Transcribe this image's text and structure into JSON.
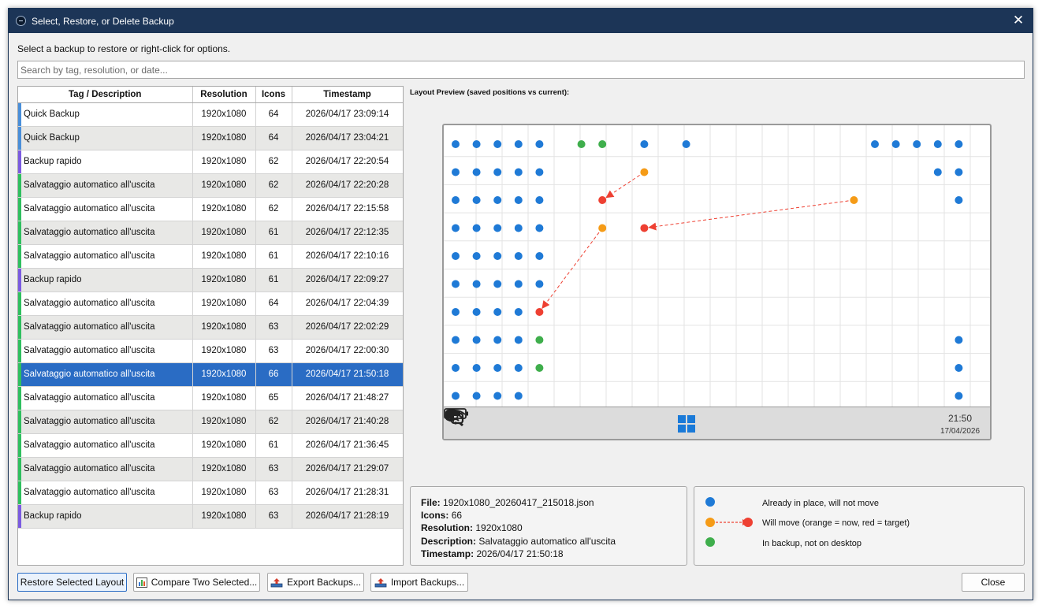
{
  "window": {
    "title": "Select, Restore, or Delete Backup",
    "close_glyph": "✕"
  },
  "instruction": "Select a backup to restore or right-click for options.",
  "search": {
    "placeholder": "Search by tag, resolution, or date...",
    "value": ""
  },
  "table": {
    "headers": [
      "Tag / Description",
      "Resolution",
      "Icons",
      "Timestamp"
    ],
    "selected_index": 11,
    "rows": [
      {
        "desc": "Quick Backup",
        "res": "1920x1080",
        "icons": "64",
        "ts": "2026/04/17 23:09:14",
        "tag_color": "#4a8fd9"
      },
      {
        "desc": "Quick Backup",
        "res": "1920x1080",
        "icons": "64",
        "ts": "2026/04/17 23:04:21",
        "tag_color": "#4a8fd9"
      },
      {
        "desc": "Backup rapido",
        "res": "1920x1080",
        "icons": "62",
        "ts": "2026/04/17 22:20:54",
        "tag_color": "#7b5be0"
      },
      {
        "desc": "Salvataggio automatico all'uscita",
        "res": "1920x1080",
        "icons": "62",
        "ts": "2026/04/17 22:20:28",
        "tag_color": "#2fbf5f"
      },
      {
        "desc": "Salvataggio automatico all'uscita",
        "res": "1920x1080",
        "icons": "62",
        "ts": "2026/04/17 22:15:58",
        "tag_color": "#2fbf5f"
      },
      {
        "desc": "Salvataggio automatico all'uscita",
        "res": "1920x1080",
        "icons": "61",
        "ts": "2026/04/17 22:12:35",
        "tag_color": "#2fbf5f"
      },
      {
        "desc": "Salvataggio automatico all'uscita",
        "res": "1920x1080",
        "icons": "61",
        "ts": "2026/04/17 22:10:16",
        "tag_color": "#2fbf5f"
      },
      {
        "desc": "Backup rapido",
        "res": "1920x1080",
        "icons": "61",
        "ts": "2026/04/17 22:09:27",
        "tag_color": "#7b5be0"
      },
      {
        "desc": "Salvataggio automatico all'uscita",
        "res": "1920x1080",
        "icons": "64",
        "ts": "2026/04/17 22:04:39",
        "tag_color": "#2fbf5f"
      },
      {
        "desc": "Salvataggio automatico all'uscita",
        "res": "1920x1080",
        "icons": "63",
        "ts": "2026/04/17 22:02:29",
        "tag_color": "#2fbf5f"
      },
      {
        "desc": "Salvataggio automatico all'uscita",
        "res": "1920x1080",
        "icons": "63",
        "ts": "2026/04/17 22:00:30",
        "tag_color": "#2fbf5f"
      },
      {
        "desc": "Salvataggio automatico all'uscita",
        "res": "1920x1080",
        "icons": "66",
        "ts": "2026/04/17 21:50:18",
        "tag_color": "#2fbf5f"
      },
      {
        "desc": "Salvataggio automatico all'uscita",
        "res": "1920x1080",
        "icons": "65",
        "ts": "2026/04/17 21:48:27",
        "tag_color": "#2fbf5f"
      },
      {
        "desc": "Salvataggio automatico all'uscita",
        "res": "1920x1080",
        "icons": "62",
        "ts": "2026/04/17 21:40:28",
        "tag_color": "#2fbf5f"
      },
      {
        "desc": "Salvataggio automatico all'uscita",
        "res": "1920x1080",
        "icons": "61",
        "ts": "2026/04/17 21:36:45",
        "tag_color": "#2fbf5f"
      },
      {
        "desc": "Salvataggio automatico all'uscita",
        "res": "1920x1080",
        "icons": "63",
        "ts": "2026/04/17 21:29:07",
        "tag_color": "#2fbf5f"
      },
      {
        "desc": "Salvataggio automatico all'uscita",
        "res": "1920x1080",
        "icons": "63",
        "ts": "2026/04/17 21:28:31",
        "tag_color": "#2fbf5f"
      },
      {
        "desc": "Backup rapido",
        "res": "1920x1080",
        "icons": "63",
        "ts": "2026/04/17 21:28:19",
        "tag_color": "#7b5be0"
      }
    ]
  },
  "preview": {
    "label": "Layout Preview (saved positions vs current):",
    "grid": {
      "cols": 21,
      "rows": 10
    },
    "colors": {
      "in_place": "#1f7ad6",
      "now": "#f59b17",
      "target": "#ee4032",
      "missing": "#3fae4c"
    },
    "icons": [
      {
        "c": 0,
        "r": 0,
        "type": "in_place"
      },
      {
        "c": 1,
        "r": 0,
        "type": "in_place"
      },
      {
        "c": 2,
        "r": 0,
        "type": "in_place"
      },
      {
        "c": 3,
        "r": 0,
        "type": "in_place"
      },
      {
        "c": 4,
        "r": 0,
        "type": "in_place"
      },
      {
        "c": 6,
        "r": 0,
        "type": "missing"
      },
      {
        "c": 7,
        "r": 0,
        "type": "missing"
      },
      {
        "c": 9,
        "r": 0,
        "type": "in_place"
      },
      {
        "c": 11,
        "r": 0,
        "type": "in_place"
      },
      {
        "c": 20,
        "r": 0,
        "type": "in_place"
      },
      {
        "c": 21,
        "r": 0,
        "type": "in_place"
      },
      {
        "c": 22,
        "r": 0,
        "type": "in_place"
      },
      {
        "c": 23,
        "r": 0,
        "type": "in_place"
      },
      {
        "c": 24,
        "r": 0,
        "type": "in_place"
      },
      {
        "c": 0,
        "r": 1,
        "type": "in_place"
      },
      {
        "c": 1,
        "r": 1,
        "type": "in_place"
      },
      {
        "c": 2,
        "r": 1,
        "type": "in_place"
      },
      {
        "c": 3,
        "r": 1,
        "type": "in_place"
      },
      {
        "c": 4,
        "r": 1,
        "type": "in_place"
      },
      {
        "c": 23,
        "r": 1,
        "type": "in_place"
      },
      {
        "c": 24,
        "r": 1,
        "type": "in_place"
      },
      {
        "c": 0,
        "r": 2,
        "type": "in_place"
      },
      {
        "c": 1,
        "r": 2,
        "type": "in_place"
      },
      {
        "c": 2,
        "r": 2,
        "type": "in_place"
      },
      {
        "c": 3,
        "r": 2,
        "type": "in_place"
      },
      {
        "c": 4,
        "r": 2,
        "type": "in_place"
      },
      {
        "c": 24,
        "r": 2,
        "type": "in_place"
      },
      {
        "c": 0,
        "r": 3,
        "type": "in_place"
      },
      {
        "c": 1,
        "r": 3,
        "type": "in_place"
      },
      {
        "c": 2,
        "r": 3,
        "type": "in_place"
      },
      {
        "c": 3,
        "r": 3,
        "type": "in_place"
      },
      {
        "c": 4,
        "r": 3,
        "type": "in_place"
      },
      {
        "c": 0,
        "r": 4,
        "type": "in_place"
      },
      {
        "c": 1,
        "r": 4,
        "type": "in_place"
      },
      {
        "c": 2,
        "r": 4,
        "type": "in_place"
      },
      {
        "c": 3,
        "r": 4,
        "type": "in_place"
      },
      {
        "c": 4,
        "r": 4,
        "type": "in_place"
      },
      {
        "c": 0,
        "r": 5,
        "type": "in_place"
      },
      {
        "c": 1,
        "r": 5,
        "type": "in_place"
      },
      {
        "c": 2,
        "r": 5,
        "type": "in_place"
      },
      {
        "c": 3,
        "r": 5,
        "type": "in_place"
      },
      {
        "c": 4,
        "r": 5,
        "type": "in_place"
      },
      {
        "c": 0,
        "r": 6,
        "type": "in_place"
      },
      {
        "c": 1,
        "r": 6,
        "type": "in_place"
      },
      {
        "c": 2,
        "r": 6,
        "type": "in_place"
      },
      {
        "c": 3,
        "r": 6,
        "type": "in_place"
      },
      {
        "c": 0,
        "r": 7,
        "type": "in_place"
      },
      {
        "c": 1,
        "r": 7,
        "type": "in_place"
      },
      {
        "c": 2,
        "r": 7,
        "type": "in_place"
      },
      {
        "c": 3,
        "r": 7,
        "type": "in_place"
      },
      {
        "c": 4,
        "r": 7,
        "type": "missing"
      },
      {
        "c": 24,
        "r": 7,
        "type": "in_place"
      },
      {
        "c": 0,
        "r": 8,
        "type": "in_place"
      },
      {
        "c": 1,
        "r": 8,
        "type": "in_place"
      },
      {
        "c": 2,
        "r": 8,
        "type": "in_place"
      },
      {
        "c": 3,
        "r": 8,
        "type": "in_place"
      },
      {
        "c": 4,
        "r": 8,
        "type": "missing"
      },
      {
        "c": 24,
        "r": 8,
        "type": "in_place"
      },
      {
        "c": 0,
        "r": 9,
        "type": "in_place"
      },
      {
        "c": 1,
        "r": 9,
        "type": "in_place"
      },
      {
        "c": 2,
        "r": 9,
        "type": "in_place"
      },
      {
        "c": 3,
        "r": 9,
        "type": "in_place"
      },
      {
        "c": 24,
        "r": 9,
        "type": "in_place"
      }
    ],
    "moves": [
      {
        "from": {
          "c": 9,
          "r": 1
        },
        "to": {
          "c": 7,
          "r": 2
        }
      },
      {
        "from": {
          "c": 19,
          "r": 2
        },
        "to": {
          "c": 9,
          "r": 3
        }
      },
      {
        "from": {
          "c": 7,
          "r": 3
        },
        "to": {
          "c": 4,
          "r": 6
        }
      }
    ],
    "taskbar": {
      "time": "21:50",
      "date": "17/04/2026"
    }
  },
  "info": {
    "file_label": "File:",
    "file": "1920x1080_20260417_215018.json",
    "icons_label": "Icons:",
    "icons": "66",
    "resolution_label": "Resolution:",
    "resolution": "1920x1080",
    "description_label": "Description:",
    "description": "Salvataggio automatico all'uscita",
    "timestamp_label": "Timestamp:",
    "timestamp": "2026/04/17 21:50:18"
  },
  "legend": {
    "in_place": "Already in place, will not move",
    "will_move": "Will move  (orange = now,  red = target)",
    "missing": "In backup, not on desktop"
  },
  "buttons": {
    "restore": "Restore Selected Layout",
    "compare": "Compare Two Selected...",
    "export": "Export Backups...",
    "import": "Import Backups...",
    "close": "Close"
  }
}
